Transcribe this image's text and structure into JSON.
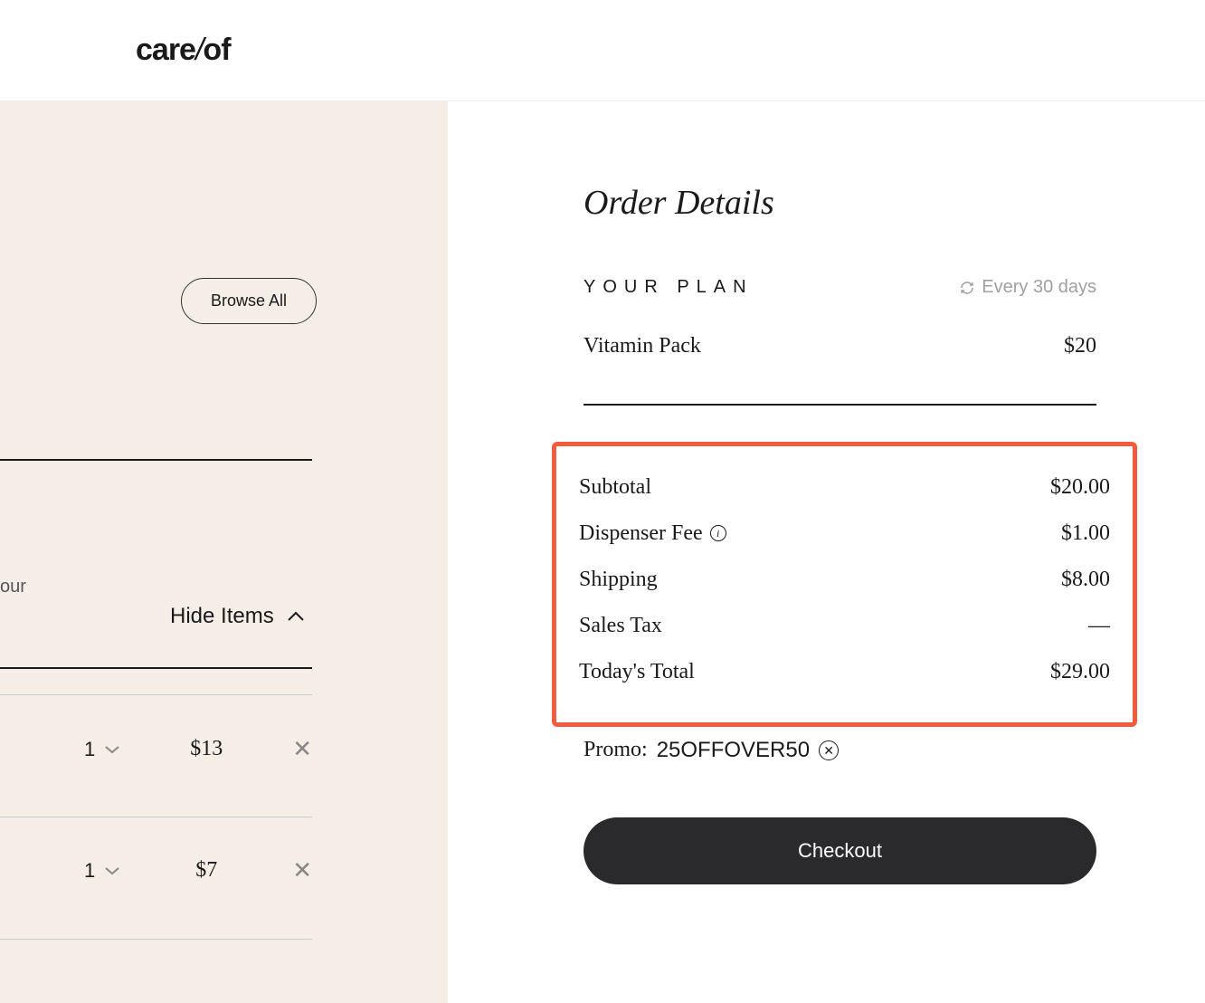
{
  "logo": {
    "part1": "care",
    "slash": "/",
    "part2": "of"
  },
  "leftPanel": {
    "browseAll": "Browse All",
    "partialText": "our",
    "hideItems": "Hide Items",
    "items": [
      {
        "qty": "1",
        "price": "$13"
      },
      {
        "qty": "1",
        "price": "$7"
      }
    ]
  },
  "orderDetails": {
    "title": "Order Details",
    "planLabel": "YOUR PLAN",
    "frequency": "Every 30 days",
    "planItem": {
      "name": "Vitamin Pack",
      "price": "$20"
    },
    "costs": {
      "subtotal": {
        "label": "Subtotal",
        "value": "$20.00"
      },
      "dispenserFee": {
        "label": "Dispenser Fee",
        "value": "$1.00"
      },
      "shipping": {
        "label": "Shipping",
        "value": "$8.00"
      },
      "salesTax": {
        "label": "Sales Tax",
        "value": "—"
      },
      "total": {
        "label": "Today's Total",
        "value": "$29.00"
      }
    },
    "promo": {
      "prefix": "Promo: ",
      "code": "25OFFOVER50"
    },
    "checkout": "Checkout"
  }
}
